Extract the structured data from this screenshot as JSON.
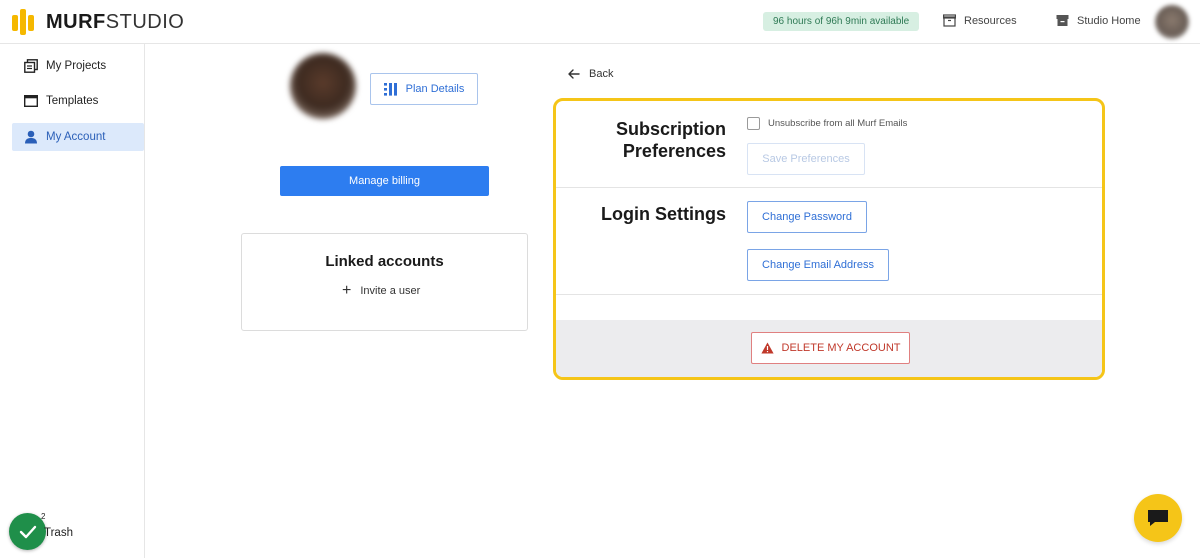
{
  "app": {
    "brand_bold": "MURF",
    "brand_light": "STUDIO",
    "brand_color": "#f5b800",
    "accent": "#2d7df0"
  },
  "header": {
    "hours_badge": "96 hours of 96h 9min available",
    "resources": "Resources",
    "studio_home": "Studio Home",
    "resources_icon": "box-icon",
    "studio_home_icon": "archive-icon"
  },
  "sidebar": {
    "items": [
      {
        "label": "My Projects",
        "icon": "projects-icon"
      },
      {
        "label": "Templates",
        "icon": "template-icon"
      },
      {
        "label": "My Account",
        "icon": "user-icon",
        "active": true
      }
    ],
    "trash": "Trash",
    "notification_count": "2"
  },
  "profile": {
    "plan_details": "Plan Details",
    "manage_billing": "Manage billing"
  },
  "linked_accounts": {
    "title": "Linked accounts",
    "invite": "Invite a user"
  },
  "settings": {
    "back": "Back",
    "subscription_title_line1": "Subscription",
    "subscription_title_line2": "Preferences",
    "unsubscribe_label": "Unsubscribe from all Murf Emails",
    "unsubscribe_checked": false,
    "save_preferences": "Save Preferences",
    "login_title": "Login Settings",
    "change_password": "Change Password",
    "change_email": "Change Email Address",
    "delete_account": "DELETE MY ACCOUNT",
    "highlight_color": "#f5c518",
    "danger_color": "#c0392b"
  }
}
